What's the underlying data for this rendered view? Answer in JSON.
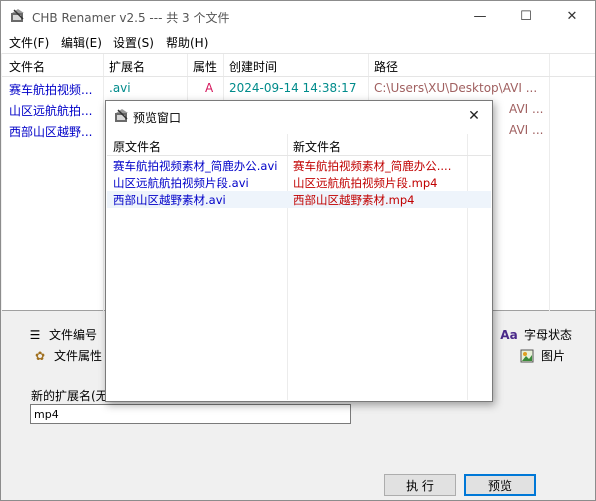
{
  "window": {
    "title": "CHB Renamer v2.5 --- 共 3 个文件",
    "minimize": "—",
    "maximize": "☐",
    "close": "✕"
  },
  "menu": [
    {
      "label": "文件(F)"
    },
    {
      "label": "编辑(E)"
    },
    {
      "label": "设置(S)"
    },
    {
      "label": "帮助(H)"
    }
  ],
  "file_list": {
    "headers": [
      "文件名",
      "扩展名",
      "属性",
      "创建时间",
      "路径"
    ],
    "rows": [
      {
        "name": "赛车航拍视频...",
        "ext": ".avi",
        "attr": "A",
        "created": "2024-09-14 14:38:17",
        "path": "C:\\Users\\XU\\Desktop\\AVI ..."
      },
      {
        "name": "山区远航航拍...",
        "ext": "",
        "attr": "",
        "created": "",
        "path": "AVI ..."
      },
      {
        "name": "西部山区越野...",
        "ext": "",
        "attr": "",
        "created": "",
        "path": "AVI ..."
      }
    ]
  },
  "tabs": {
    "file_number": "文件编号",
    "file_attr": "文件属性",
    "letter_case": "字母状态",
    "picture": "图片"
  },
  "extension": {
    "label": "新的扩展名(无",
    "value": "mp4"
  },
  "buttons": {
    "execute": "执 行",
    "preview": "预览"
  },
  "preview_dialog": {
    "title": "预览窗口",
    "close": "✕",
    "headers": [
      "原文件名",
      "新文件名"
    ],
    "rows": [
      {
        "old": "赛车航拍视频素材_简鹿办公.avi",
        "new": "赛车航拍视频素材_简鹿办公...."
      },
      {
        "old": "山区远航航拍视频片段.avi",
        "new": "山区远航航拍视频片段.mp4"
      },
      {
        "old": "西部山区越野素材.avi",
        "new": "西部山区越野素材.mp4"
      }
    ]
  },
  "colors": {
    "link_blue": "#0000c8",
    "ext_teal": "#008b8b",
    "attr_red": "#d4145a",
    "new_name_red": "#c00000",
    "accent": "#0078d7"
  }
}
